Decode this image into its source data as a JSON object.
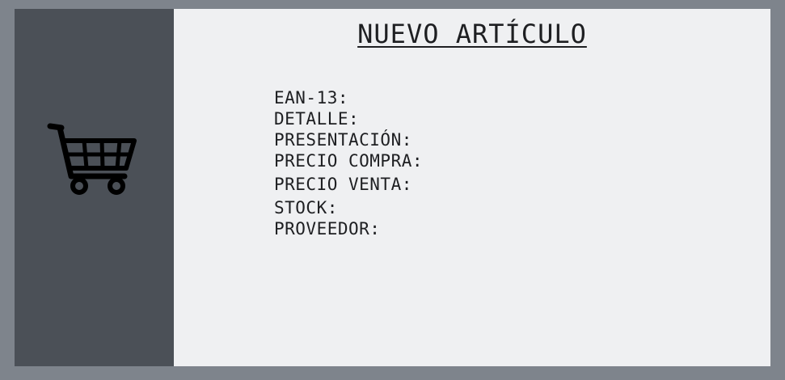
{
  "sidebar": {
    "icon": "shopping-cart-icon"
  },
  "main": {
    "title": "NUEVO ARTÍCULO",
    "fields": [
      {
        "label": "EAN-13:"
      },
      {
        "label": "DETALLE:"
      },
      {
        "label": "PRESENTACIÓN:"
      },
      {
        "label": "PRECIO COMPRA:"
      },
      {
        "label": "PRECIO VENTA:"
      },
      {
        "label": "STOCK:"
      },
      {
        "label": "PROVEEDOR:"
      }
    ]
  },
  "colors": {
    "background": "#7e848c",
    "sidebar": "#4b5057",
    "panel": "#eff0f2",
    "text": "#1e1f22"
  }
}
